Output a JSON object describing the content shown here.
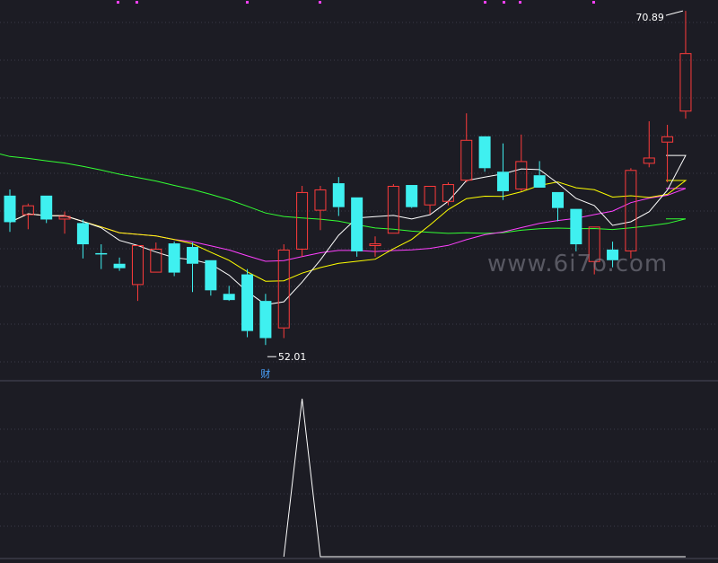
{
  "chart_data": {
    "type": "candlestick",
    "title": "",
    "watermark": "www.6i7o.com",
    "high_label": "70.89",
    "low_label": "52.01",
    "event_marker": "财",
    "colors": {
      "background": "#1c1c24",
      "up": "#ff3b3b",
      "down": "#3ff0f0",
      "ma5": "#ffffff",
      "ma10": "#ffff00",
      "ma20": "#ff40ff",
      "ma60": "#33ff33",
      "indicator": "#ffffff",
      "grid": "#3a3a48"
    },
    "ylim": [
      50.6,
      71.3
    ],
    "candles": [
      {
        "o": 60.45,
        "h": 60.8,
        "l": 58.4,
        "c": 58.95
      },
      {
        "o": 59.35,
        "h": 60.0,
        "l": 58.55,
        "c": 59.9
      },
      {
        "o": 60.45,
        "h": 60.45,
        "l": 58.9,
        "c": 59.1
      },
      {
        "o": 59.1,
        "h": 59.55,
        "l": 58.3,
        "c": 59.3
      },
      {
        "o": 58.9,
        "h": 59.1,
        "l": 56.9,
        "c": 57.7
      },
      {
        "o": 57.2,
        "h": 57.7,
        "l": 56.3,
        "c": 57.15
      },
      {
        "o": 56.6,
        "h": 56.95,
        "l": 56.2,
        "c": 56.35
      },
      {
        "o": 55.4,
        "h": 57.6,
        "l": 54.5,
        "c": 57.65
      },
      {
        "o": 56.1,
        "h": 57.8,
        "l": 56.1,
        "c": 57.45
      },
      {
        "o": 57.75,
        "h": 57.85,
        "l": 55.9,
        "c": 56.1
      },
      {
        "o": 57.55,
        "h": 57.8,
        "l": 55.0,
        "c": 56.6
      },
      {
        "o": 56.8,
        "h": 56.8,
        "l": 54.8,
        "c": 55.1
      },
      {
        "o": 54.9,
        "h": 55.35,
        "l": 54.5,
        "c": 54.55
      },
      {
        "o": 56.0,
        "h": 56.3,
        "l": 52.45,
        "c": 52.8
      },
      {
        "o": 54.5,
        "h": 54.9,
        "l": 52.01,
        "c": 52.4
      },
      {
        "o": 52.95,
        "h": 57.7,
        "l": 52.4,
        "c": 57.4
      },
      {
        "o": 57.4,
        "h": 61.0,
        "l": 57.0,
        "c": 60.65
      },
      {
        "o": 59.6,
        "h": 61.0,
        "l": 58.5,
        "c": 60.8
      },
      {
        "o": 61.15,
        "h": 61.5,
        "l": 59.3,
        "c": 59.8
      },
      {
        "o": 60.35,
        "h": 60.35,
        "l": 57.0,
        "c": 57.3
      },
      {
        "o": 57.6,
        "h": 58.15,
        "l": 57.0,
        "c": 57.75
      },
      {
        "o": 58.3,
        "h": 61.1,
        "l": 58.3,
        "c": 61.0
      },
      {
        "o": 61.05,
        "h": 61.05,
        "l": 59.75,
        "c": 59.8
      },
      {
        "o": 59.9,
        "h": 61.0,
        "l": 59.4,
        "c": 61.0
      },
      {
        "o": 60.1,
        "h": 61.2,
        "l": 59.9,
        "c": 61.1
      },
      {
        "o": 61.3,
        "h": 65.1,
        "l": 61.2,
        "c": 63.6
      },
      {
        "o": 63.8,
        "h": 63.8,
        "l": 61.8,
        "c": 62.0
      },
      {
        "o": 61.8,
        "h": 63.4,
        "l": 60.2,
        "c": 60.7
      },
      {
        "o": 60.8,
        "h": 63.9,
        "l": 60.7,
        "c": 62.4
      },
      {
        "o": 61.6,
        "h": 62.4,
        "l": 60.9,
        "c": 60.9
      },
      {
        "o": 60.65,
        "h": 60.65,
        "l": 59.0,
        "c": 59.75
      },
      {
        "o": 59.7,
        "h": 59.7,
        "l": 57.3,
        "c": 57.7
      },
      {
        "o": 56.7,
        "h": 58.7,
        "l": 56.0,
        "c": 58.7
      },
      {
        "o": 57.4,
        "h": 57.85,
        "l": 56.4,
        "c": 56.8
      },
      {
        "o": 57.3,
        "h": 62.0,
        "l": 56.9,
        "c": 61.9
      },
      {
        "o": 62.25,
        "h": 64.65,
        "l": 62.05,
        "c": 62.6
      },
      {
        "o": 63.45,
        "h": 64.45,
        "l": 61.2,
        "c": 63.8
      },
      {
        "o": 65.2,
        "h": 70.89,
        "l": 64.8,
        "c": 68.5
      }
    ],
    "indicator": {
      "values": [
        0,
        0,
        0,
        0,
        0,
        0,
        0,
        0,
        0,
        0,
        0,
        0,
        0,
        0,
        0,
        0,
        1,
        0,
        0,
        0,
        0,
        0,
        0,
        0,
        0,
        0,
        0,
        0,
        0,
        0,
        0,
        0,
        0,
        0,
        0,
        0,
        0,
        0
      ],
      "ylim": [
        0,
        1
      ]
    }
  }
}
